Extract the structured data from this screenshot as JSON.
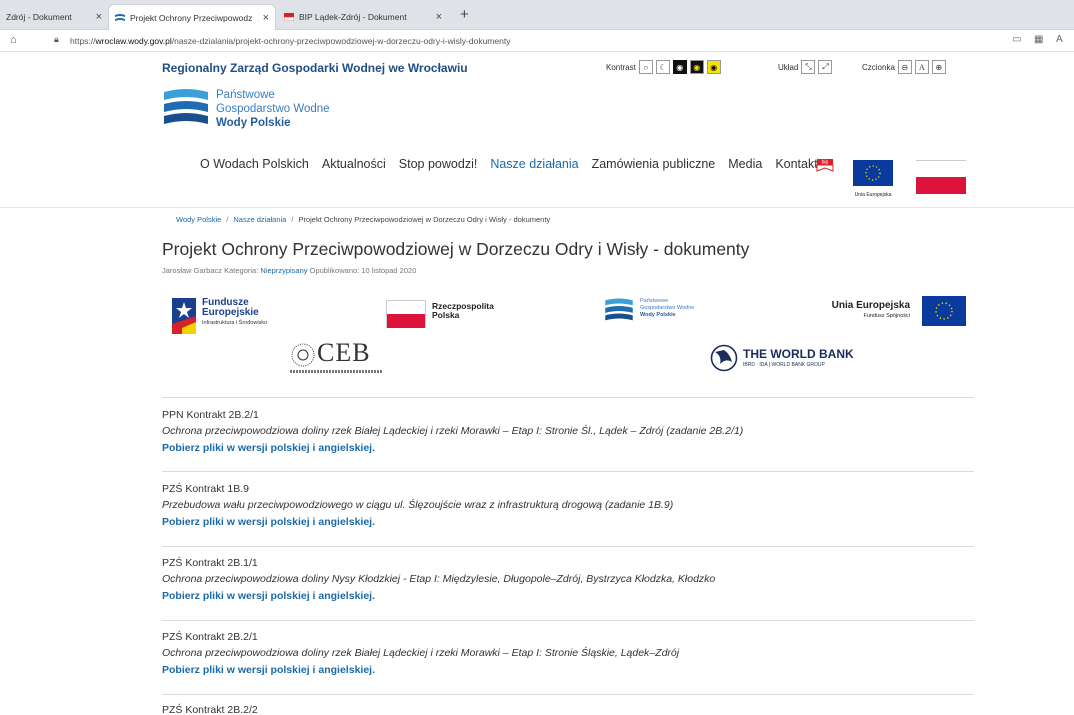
{
  "browser": {
    "tabs": [
      {
        "title": "Zdrój - Dokument"
      },
      {
        "title": "Projekt Ochrony Przeciwpowodz"
      },
      {
        "title": "BIP Lądek-Zdrój - Dokument"
      }
    ],
    "new_tab_glyph": "+",
    "close_glyph": "×",
    "url_prefix": "https://",
    "url_host": "wroclaw.wody.gov.pl",
    "url_path": "/nasze-dzialania/projekt-ochrony-przeciwpowodziowej-w-dorzeczu-odry-i-wisly-dokumenty"
  },
  "header": {
    "org_name": "Regionalny Zarząd Gospodarki Wodnej we Wrocławiu",
    "contrast_label": "Kontrast",
    "layout_label": "Układ",
    "font_label": "Czcionka",
    "font_button": "A",
    "logo_line1": "Państwowe",
    "logo_line2": "Gospodarstwo Wodne",
    "logo_line3": "Wody Polskie",
    "eu_caption": "Unia Europejska",
    "bip_label": "bip"
  },
  "nav": {
    "items": [
      "O Wodach Polskich",
      "Aktualności",
      "Stop powodzi!",
      "Nasze działania",
      "Zamówienia publiczne",
      "Media",
      "Kontakt"
    ]
  },
  "breadcrumb": {
    "home": "Wody Polskie",
    "section": "Nasze działania",
    "current": "Projekt Ochrony Przeciwpowodziowej w Dorzeczu Odry i Wisły - dokumenty",
    "separator": "/"
  },
  "article": {
    "title": "Projekt Ochrony Przeciwpowodziowej w Dorzeczu Odry i Wisły - dokumenty",
    "author": "Jarosław Garbacz",
    "category_label": "Kategoria:",
    "category": "Nieprzypisany",
    "published": "Opublikowano: 10 listopad 2020"
  },
  "logos": {
    "fe_line1": "Fundusze",
    "fe_line2": "Europejskie",
    "fe_line3": "Infrastruktura i Środowisko",
    "rp_line1": "Rzeczpospolita",
    "rp_line2": "Polska",
    "wp_line1": "Państwowe",
    "wp_line2": "Gospodarstwo Wodne",
    "wp_line3": "Wody Polskie",
    "ue_line1": "Unia Europejska",
    "ue_line2": "Fundusz Spójności",
    "ceb": "CEB",
    "wb_line1": "THE WORLD BANK",
    "wb_line2": "IBRD · IDA | WORLD BANK GROUP"
  },
  "contracts": [
    {
      "heading": "PPN Kontrakt 2B.2/1",
      "desc": "Ochrona przeciwpowodziowa doliny rzek Białej Lądeckiej i rzeki Morawki – Etap I: Stronie Śl., Lądek – Zdrój (zadanie 2B.2/1)",
      "link": "Pobierz pliki w wersji polskiej i angielskiej."
    },
    {
      "heading": "PZŚ Kontrakt 1B.9",
      "desc": "Przebudowa wału przeciwpowodziowego w ciągu ul. Ślęzoujście wraz z infrastrukturą drogową (zadanie 1B.9)",
      "link": "Pobierz pliki w wersji polskiej i angielskiej."
    },
    {
      "heading": "PZŚ Kontrakt 2B.1/1",
      "desc": "Ochrona przeciwpowodziowa doliny Nysy Kłodzkiej - Etap I: Międzylesie, Długopole–Zdrój, Bystrzyca Kłodzka, Kłodzko",
      "link": "Pobierz pliki w wersji polskiej i angielskiej."
    },
    {
      "heading": "PZŚ Kontrakt 2B.2/1",
      "desc": "Ochrona przeciwpowodziowa doliny rzek Białej Lądeckiej i rzeki Morawki – Etap I: Stronie Śląskie, Lądek–Zdrój",
      "link": "Pobierz pliki w wersji polskiej i angielskiej."
    },
    {
      "heading": "PZŚ Kontrakt 2B.2/2",
      "desc": "",
      "link": ""
    }
  ]
}
